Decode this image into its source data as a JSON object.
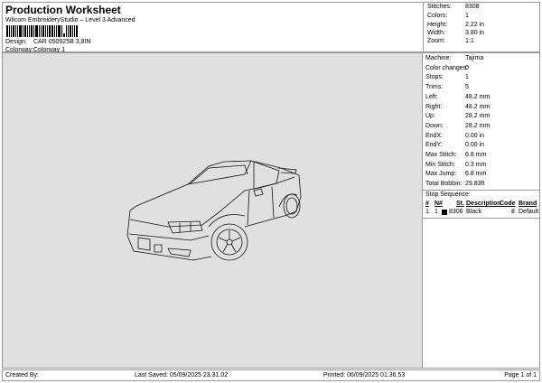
{
  "header": {
    "title": "Production Worksheet",
    "subtitle": "Wilcom EmbroideryStudio – Level 3 Advanced",
    "design_label": "Design:",
    "design_value": "CAR 050925B 3,8IN",
    "colorway_label": "Colorway:",
    "colorway_value": "Colorway 1"
  },
  "stats": [
    {
      "label": "Stitches:",
      "value": "8308"
    },
    {
      "label": "Colors:",
      "value": "1"
    },
    {
      "label": "Height:",
      "value": "2.22 in"
    },
    {
      "label": "Width:",
      "value": "3.80 in"
    },
    {
      "label": "Zoom:",
      "value": "1:1"
    }
  ],
  "details": [
    {
      "label": "Machine:",
      "value": "Tajima"
    },
    {
      "label": "Color changes:",
      "value": "0"
    },
    {
      "label": "Stops:",
      "value": "1"
    },
    {
      "label": "Trims:",
      "value": "5"
    },
    {
      "label": "Left:",
      "value": "48.2 mm"
    },
    {
      "label": "Right:",
      "value": "48.2 mm"
    },
    {
      "label": "Up:",
      "value": "28.2 mm"
    },
    {
      "label": "Down:",
      "value": "28.2 mm"
    },
    {
      "label": "EndX:",
      "value": "0.00 in"
    },
    {
      "label": "EndY:",
      "value": "0.00 in"
    },
    {
      "label": "Max Stitch:",
      "value": "6.8 mm"
    },
    {
      "label": "Min Stitch:",
      "value": "0.3 mm"
    },
    {
      "label": "Max Jump:",
      "value": "6.8 mm"
    },
    {
      "label": "Total Bobbin:",
      "value": "29.83ft"
    }
  ],
  "stop_sequence": {
    "title": "Stop Sequence:",
    "columns": [
      "#",
      "N#",
      "St.",
      "Description",
      "Code",
      "Brand"
    ],
    "rows": [
      {
        "num": "1.",
        "n": "1",
        "color": "#000000",
        "st": "8306",
        "description": "Black",
        "code": "8",
        "brand": "Default"
      }
    ]
  },
  "footer": {
    "created_by": "Created By:",
    "last_saved": "Last Saved: 05/09/2025 23.31.02",
    "printed": "Printed: 06/09/2025 01.36.53",
    "page": "Page 1 of 1"
  }
}
